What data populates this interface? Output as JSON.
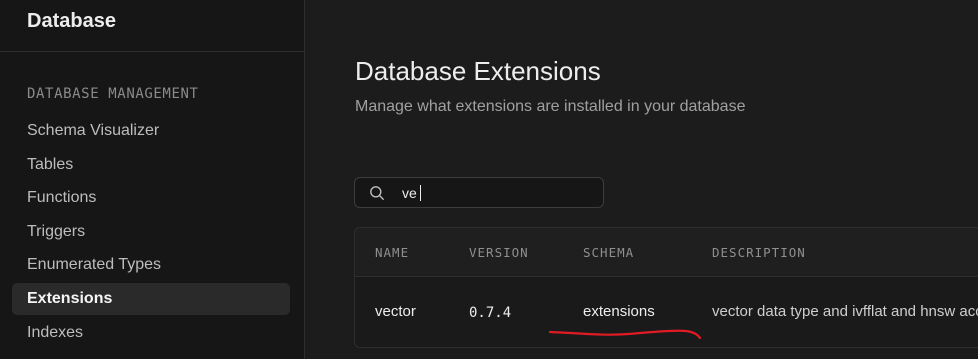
{
  "sidebar": {
    "title": "Database",
    "section_label": "DATABASE MANAGEMENT",
    "items": [
      {
        "label": "Schema Visualizer",
        "active": false
      },
      {
        "label": "Tables",
        "active": false
      },
      {
        "label": "Functions",
        "active": false
      },
      {
        "label": "Triggers",
        "active": false
      },
      {
        "label": "Enumerated Types",
        "active": false
      },
      {
        "label": "Extensions",
        "active": true
      },
      {
        "label": "Indexes",
        "active": false
      }
    ]
  },
  "main": {
    "title": "Database Extensions",
    "subtitle": "Manage what extensions are installed in your database",
    "search": {
      "value": "ve",
      "placeholder": ""
    },
    "table": {
      "columns": [
        "NAME",
        "VERSION",
        "SCHEMA",
        "DESCRIPTION"
      ],
      "rows": [
        {
          "name": "vector",
          "version": "0.7.4",
          "schema": "extensions",
          "description": "vector data type and ivfflat and hnsw access methods"
        }
      ]
    }
  },
  "colors": {
    "background": "#1c1c1c",
    "sidebar_background": "#161616",
    "active_item_background": "#2a2a2a",
    "border": "#2e2e2e",
    "annotation_red": "#e01b24"
  }
}
